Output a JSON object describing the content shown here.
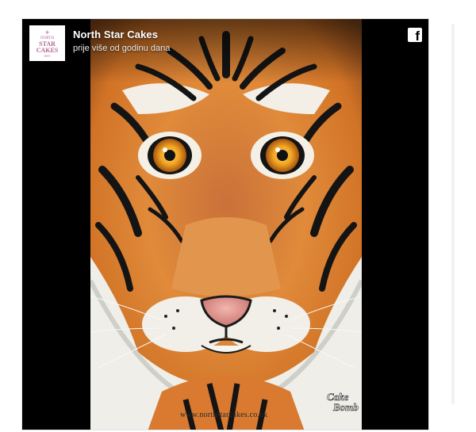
{
  "post": {
    "page_name": "North Star Cakes",
    "time": "prije više od godinu dana",
    "logo": {
      "line1": "NORTH",
      "line2": "STAR",
      "line3": "CAKES",
      "line4": "2015"
    }
  },
  "photo": {
    "watermark_url": "www.northstarcakes.co.uk",
    "watermark_brand_line1": "Cake",
    "watermark_brand_line2": "Bomb"
  },
  "icons": {
    "share": "facebook-icon"
  },
  "colors": {
    "card_background": "#000000",
    "tiger_orange": "#d9782e",
    "stripe": "#141414"
  }
}
